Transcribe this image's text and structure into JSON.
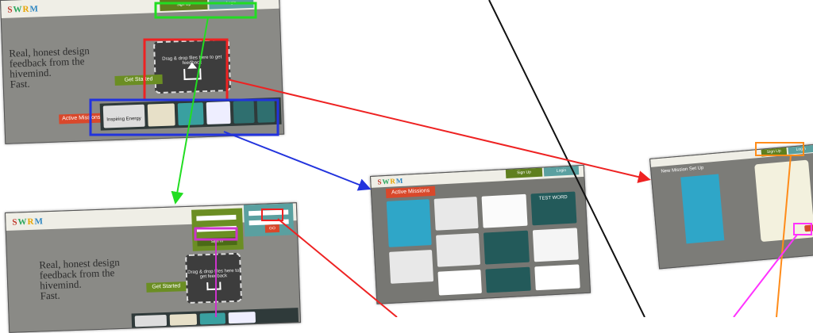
{
  "logo_text": "SWRM",
  "landing": {
    "tagline": [
      "Real, honest design",
      "feedback from the",
      "hivemind.",
      "Fast."
    ],
    "sign_up": "Sign Up",
    "login": "Login",
    "drop_text": "Drag & drop files here to get feedback",
    "get_started": "Get Started",
    "active_missions": "Active Missions",
    "thumb_label": "Inspiring Energy"
  },
  "login_screen": {
    "sign_in": "Sign In",
    "go": "GO",
    "drop_text": "Drag & drop files here to get feedback",
    "get_started": "Get Started",
    "tagline": [
      "Real, honest design",
      "feedback from the",
      "hivemind.",
      "Fast."
    ]
  },
  "missions_screen": {
    "title": "Active Missions",
    "sign_up": "Sign Up",
    "login": "Login",
    "test_word": "TEST WORD"
  },
  "setup_screen": {
    "title": "New Mission Set Up",
    "sign_up": "Sign Up",
    "login": "Login"
  },
  "colors": {
    "green": "#22dd22",
    "red": "#ee2222",
    "blue": "#2233dd",
    "orange": "#ff8c1a",
    "magenta": "#ff33ff",
    "black": "#111111"
  }
}
